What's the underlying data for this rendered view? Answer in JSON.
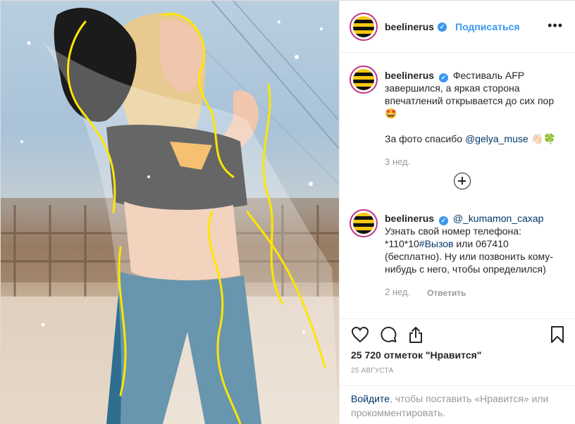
{
  "post": {
    "author": "beelinerus",
    "follow_label": "Подписаться",
    "more_icon": "more-icon",
    "brand_colors": {
      "link": "#3897f0",
      "text": "#262626",
      "muted": "#999999",
      "ring": "#c13584"
    }
  },
  "comments": [
    {
      "author": "beelinerus",
      "text_lines": [
        "Фестиваль AFP",
        "завершился, а яркая сторона",
        "впечатлений открывается до сих пор"
      ],
      "emoji": "🤩",
      "thanks_prefix": "За фото спасибо",
      "thanks_link": "@gelya_muse",
      "thanks_emoji": "👋🏻🍀",
      "time": "3 нед."
    },
    {
      "author": "beelinerus",
      "mention": "@_kumamon_caxap",
      "line1": "Узнать свой номер телефона:",
      "line2_prefix": "*110*10",
      "line2_tag": "#Вызов",
      "line2_suffix": " или 067410",
      "line3": "(бесплатно). Ну или позвонить кому-",
      "line4": "нибудь с него, чтобы определился)",
      "time": "2 нед.",
      "reply_label": "Ответить"
    }
  ],
  "load_more_icon": "plus-circle-icon",
  "actions": {
    "likes": "25 720 отметок \"Нравится\"",
    "date": "25 АВГУСТА"
  },
  "login": {
    "link": "Войдите",
    "text": ", чтобы поставить «Нравится» или",
    "text2": "прокомментировать."
  }
}
